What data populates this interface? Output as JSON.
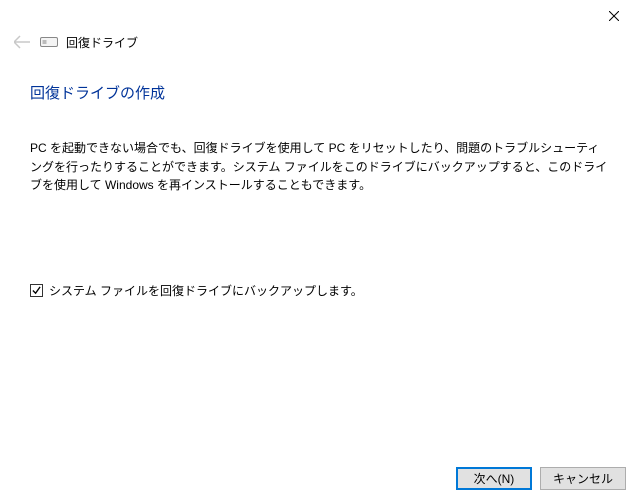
{
  "header": {
    "window_title": "回復ドライブ"
  },
  "content": {
    "page_title": "回復ドライブの作成",
    "description": "PC を起動できない場合でも、回復ドライブを使用して PC をリセットしたり、問題のトラブルシューティングを行ったりすることができます。システム ファイルをこのドライブにバックアップすると、このドライブを使用して Windows を再インストールすることもできます。"
  },
  "checkbox": {
    "label": "システム ファイルを回復ドライブにバックアップします。",
    "checked": true
  },
  "footer": {
    "next_label": "次へ(N)",
    "cancel_label": "キャンセル"
  }
}
